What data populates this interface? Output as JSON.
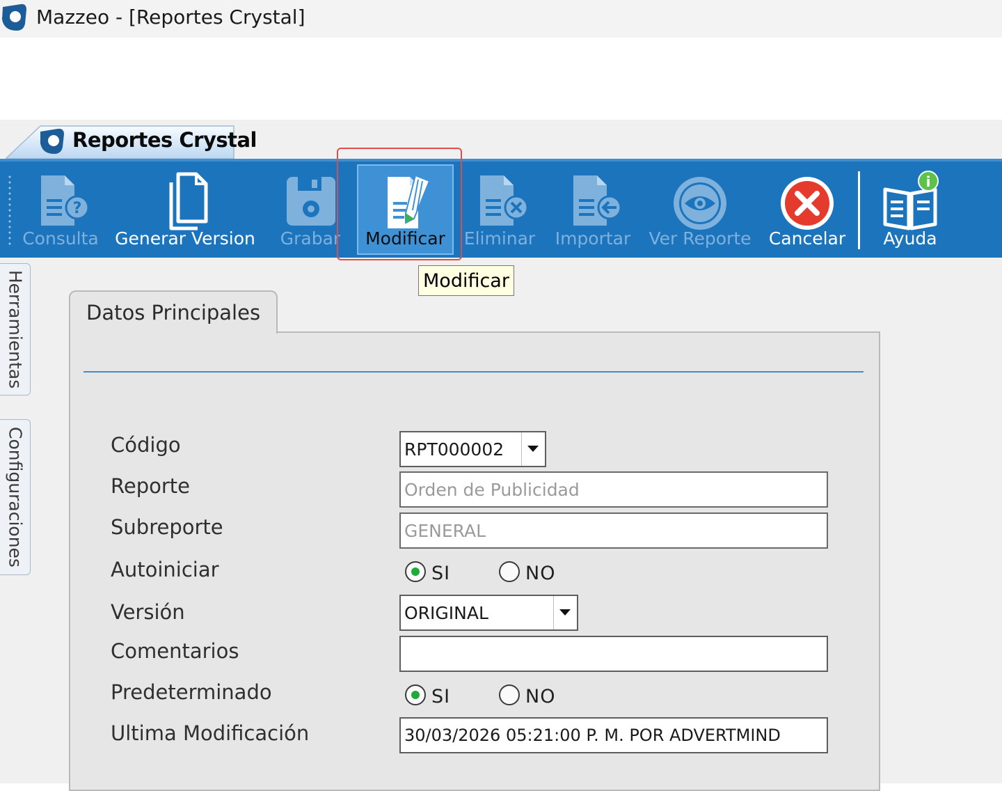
{
  "window": {
    "title": "Mazzeo - [Reportes Crystal]"
  },
  "document_tab": {
    "label": "Reportes Crystal"
  },
  "toolbar": {
    "buttons": [
      {
        "label": "Consulta",
        "enabled": false,
        "icon": "document-question-icon"
      },
      {
        "label": "Generar Version",
        "enabled": true,
        "icon": "copy-document-icon"
      },
      {
        "label": "Grabar",
        "enabled": false,
        "icon": "floppy-save-icon"
      },
      {
        "label": "Modificar",
        "enabled": true,
        "icon": "edit-document-icon",
        "state": "hovered"
      },
      {
        "label": "Eliminar",
        "enabled": false,
        "icon": "document-delete-icon"
      },
      {
        "label": "Importar",
        "enabled": false,
        "icon": "document-import-icon"
      },
      {
        "label": "Ver Reporte",
        "enabled": false,
        "icon": "eye-icon"
      },
      {
        "label": "Cancelar",
        "enabled": true,
        "icon": "cancel-x-icon"
      },
      {
        "label": "Ayuda",
        "enabled": true,
        "icon": "help-book-icon"
      }
    ]
  },
  "tooltip": {
    "text": "Modificar"
  },
  "side_tabs": {
    "herramientas": "Herramientas",
    "configuraciones": "Configuraciones"
  },
  "form": {
    "tab_label": "Datos Principales",
    "codigo": {
      "label": "Código",
      "value": "RPT000002"
    },
    "reporte": {
      "label": "Reporte",
      "value": "Orden de Publicidad"
    },
    "subreporte": {
      "label": "Subreporte",
      "value": "GENERAL"
    },
    "autoiniciar": {
      "label": "Autoiniciar",
      "yes": "SI",
      "no": "NO",
      "selected": "SI"
    },
    "version": {
      "label": "Versión",
      "value": "ORIGINAL"
    },
    "comentarios": {
      "label": "Comentarios",
      "value": ""
    },
    "predeterminado": {
      "label": "Predeterminado",
      "yes": "SI",
      "no": "NO",
      "selected": "SI"
    },
    "ultima_modificacion": {
      "label": "Ultima Modificación",
      "value": "30/03/2026 05:21:00 P. M. POR ADVERTMIND"
    }
  },
  "colors": {
    "toolbar_blue": "#1c74bd",
    "hover_blue": "#3f91d6",
    "disabled_label": "#7fb1dd",
    "cancel_red": "#e53b2c",
    "radio_green": "#1faa3c",
    "highlight_red": "#e24b4b"
  }
}
